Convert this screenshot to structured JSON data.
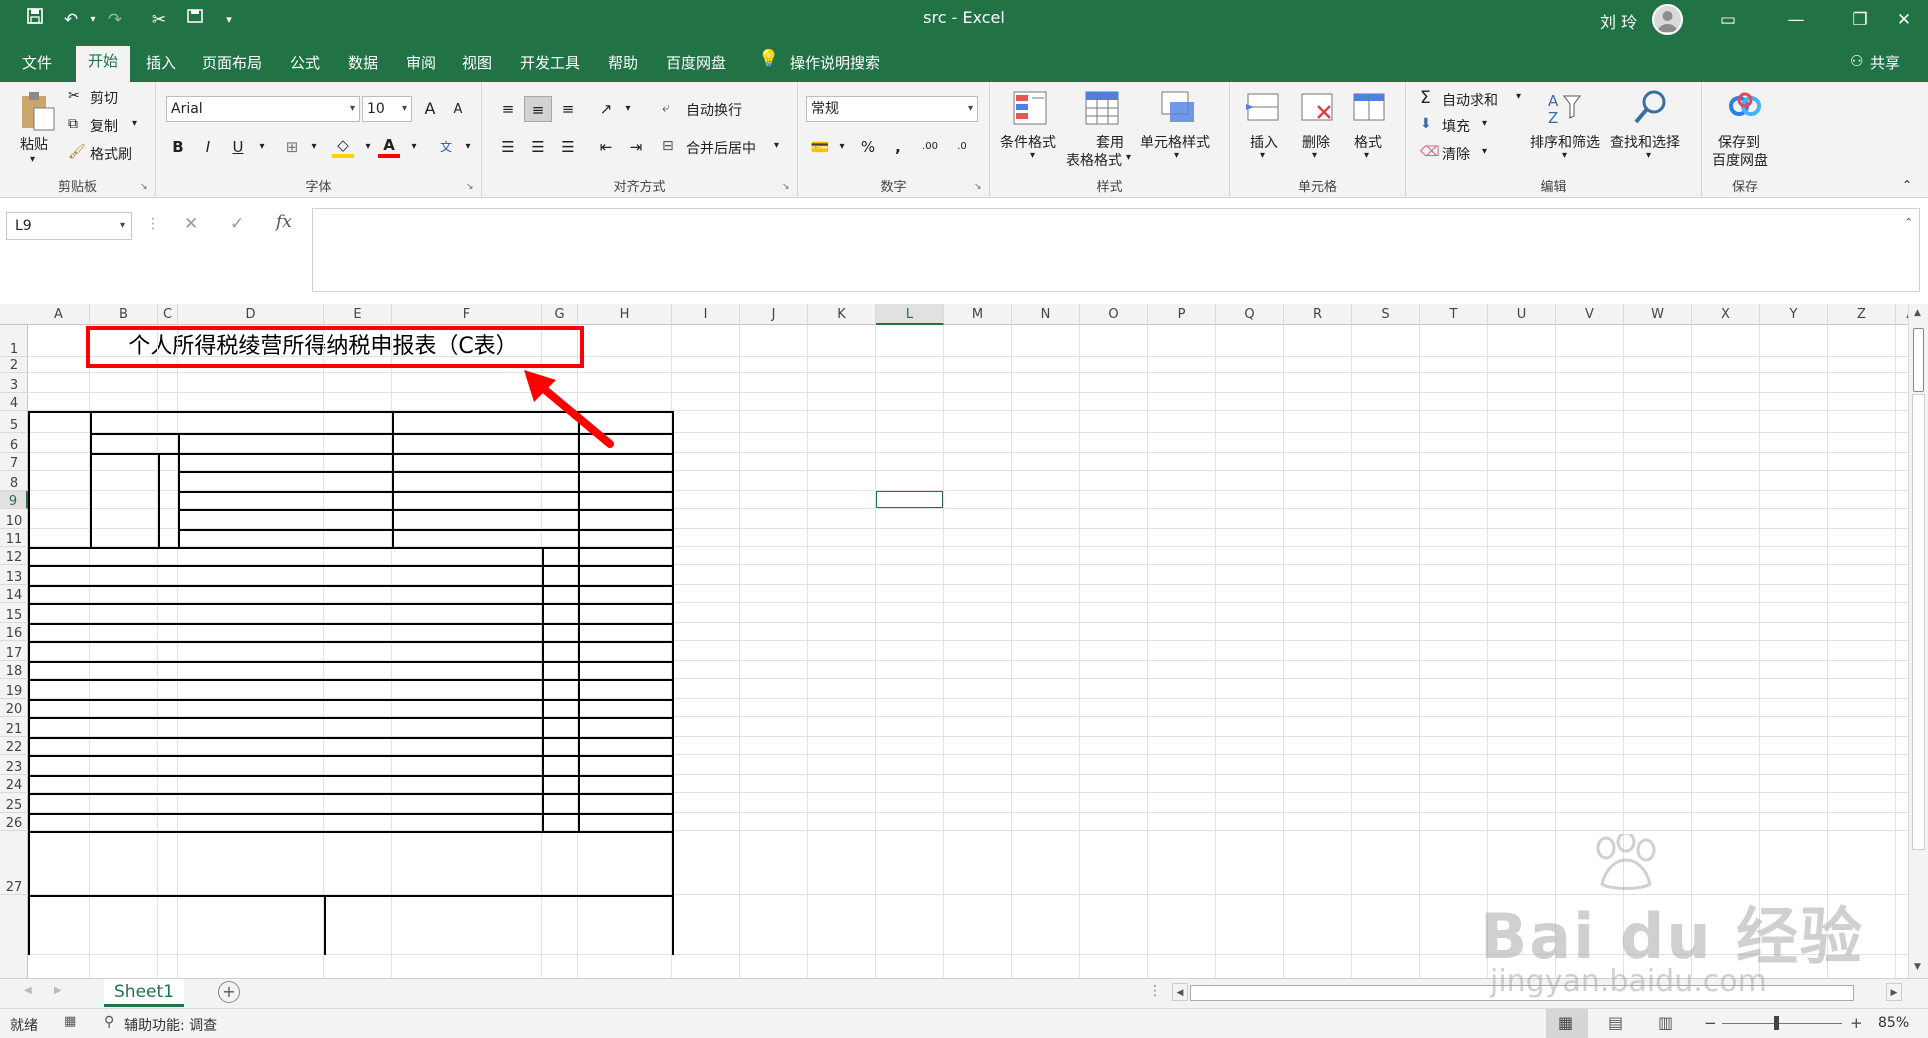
{
  "window": {
    "title": "src  -  Excel",
    "user": "刘 玲"
  },
  "tabs": [
    "文件",
    "开始",
    "插入",
    "页面布局",
    "公式",
    "数据",
    "审阅",
    "视图",
    "开发工具",
    "帮助",
    "百度网盘",
    "操作说明搜索"
  ],
  "share_label": "共享",
  "ribbon": {
    "clipboard": {
      "paste": "粘贴",
      "cut": "剪切",
      "copy": "复制",
      "format_painter": "格式刷",
      "label": "剪贴板"
    },
    "font": {
      "name": "Arial",
      "size": "10",
      "bold": "B",
      "italic": "I",
      "underline": "U",
      "label": "字体",
      "grow": "A",
      "shrink": "A",
      "phonetic": "文"
    },
    "alignment": {
      "wrap": "自动换行",
      "merge": "合并后居中",
      "label": "对齐方式"
    },
    "number": {
      "format": "常规",
      "percent": "%",
      "comma": ",",
      "inc_decimal": ".00",
      "dec_decimal": ".0",
      "label": "数字"
    },
    "styles": {
      "conditional": "条件格式",
      "table_l1": "套用",
      "table_l2": "表格格式",
      "cell_styles": "单元格样式",
      "label": "样式"
    },
    "cells": {
      "insert": "插入",
      "delete": "删除",
      "format": "格式",
      "label": "单元格"
    },
    "editing": {
      "autosum": "自动求和",
      "fill": "填充",
      "clear": "清除",
      "sort": "排序和筛选",
      "find": "查找和选择",
      "label": "编辑"
    },
    "save": {
      "l1": "保存到",
      "l2": "百度网盘",
      "label": "保存"
    }
  },
  "formula_bar": {
    "name_box": "L9",
    "fx": "fx",
    "cancel": "✕",
    "enter": "✓",
    "value": ""
  },
  "columns": [
    "A",
    "B",
    "C",
    "D",
    "E",
    "F",
    "G",
    "H",
    "I",
    "J",
    "K",
    "L",
    "M",
    "N",
    "O",
    "P",
    "Q",
    "R",
    "S",
    "T",
    "U",
    "V",
    "W",
    "X",
    "Y",
    "Z",
    "AA"
  ],
  "rows": [
    "1",
    "2",
    "3",
    "4",
    "5",
    "6",
    "7",
    "8",
    "9",
    "10",
    "11",
    "12",
    "13",
    "14",
    "15",
    "16",
    "17",
    "18",
    "19",
    "20",
    "21",
    "22",
    "23",
    "24",
    "25",
    "26",
    "27"
  ],
  "selected_cell": {
    "col": "L",
    "row": "9"
  },
  "sheet_title": "个人所得税绫营所得纳税申报表（C表）",
  "sheet_tab": "Sheet1",
  "status": {
    "ready": "就绪",
    "accessibility": "辅助功能: 调查",
    "zoom": "85%"
  },
  "watermark": {
    "brand": "Bai du 经验",
    "url": "jingyan.baidu.com"
  },
  "colors": {
    "accent": "#217346",
    "annotation": "#ff0000"
  }
}
